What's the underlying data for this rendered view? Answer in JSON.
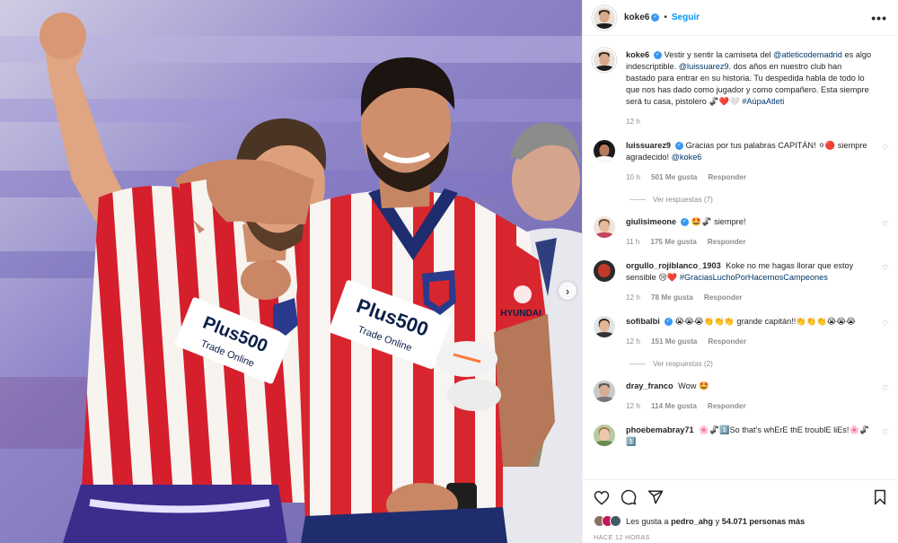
{
  "post": {
    "author": "koke6",
    "follow_label": "Seguir",
    "dot": "•",
    "more": "•••"
  },
  "photo": {
    "left_shirt_sponsor_1": "Plus500",
    "left_shirt_sponsor_2": "Trade Online",
    "right_shirt_sponsor_1": "Plus500",
    "right_shirt_sponsor_2": "Trade Online",
    "sleeve_brand": "HYUNDAI"
  },
  "caption": {
    "user": "koke6",
    "part1": "Vestir y sentir la camiseta del ",
    "mention1": "@atleticodemadrid",
    "part2": " es algo indescriptible. ",
    "mention2": "@luissuarez9",
    "part3": ". dos años en nuestro club han bastado para entrar en su historia. Tu despedida habla de todo lo que nos has dado como jugador y como compañero. Esta siempre será tu casa, pistolero 🦨❤️🤍 ",
    "hashtag": "#AúpaAtleti",
    "time": "12 h"
  },
  "comments": [
    {
      "user": "luissuarez9",
      "verified": true,
      "text": "Gracias por tus palabras CAPITÁN! ⚪🔴 siempre agradecido! ",
      "mention": "@koke6",
      "time": "10 h",
      "likes": "501 Me gusta",
      "reply": "Responder",
      "view_replies": "Ver respuestas (7)"
    },
    {
      "user": "giulisimeone",
      "verified": true,
      "text": "🤩🦨 siempre!",
      "time": "11 h",
      "likes": "175 Me gusta",
      "reply": "Responder"
    },
    {
      "user": "orgullo_rojiblanco_1903",
      "verified": false,
      "text": "Koke no me hagas llorar que estoy sensible 😢❤️ ",
      "mention": "#GraciasLuchoPorHacernosCampeones",
      "time": "12 h",
      "likes": "78 Me gusta",
      "reply": "Responder"
    },
    {
      "user": "sofibalbi",
      "verified": true,
      "text": "😭😭😭👏👏👏 grande capitán!!👏👏👏😭😭😭",
      "time": "12 h",
      "likes": "151 Me gusta",
      "reply": "Responder",
      "view_replies": "Ver respuestas (2)"
    },
    {
      "user": "dray_franco",
      "verified": false,
      "text": "Wow 🤩",
      "time": "12 h",
      "likes": "114 Me gusta",
      "reply": "Responder"
    },
    {
      "user": "phoebemabray71",
      "verified": false,
      "text": "🌸🦨1️⃣So that's whErE thE troublE liEs!🌸🦨1️⃣",
      "time": "",
      "likes": "",
      "reply": ""
    }
  ],
  "likes": {
    "prefix": "Les gusta a ",
    "user": "pedro_ahg",
    "middle": " y ",
    "count": "54.071 personas más"
  },
  "time_ago": "HACE 12 HORAS",
  "icons": [
    "heart-icon",
    "comment-icon",
    "share-icon",
    "bookmark-icon"
  ]
}
